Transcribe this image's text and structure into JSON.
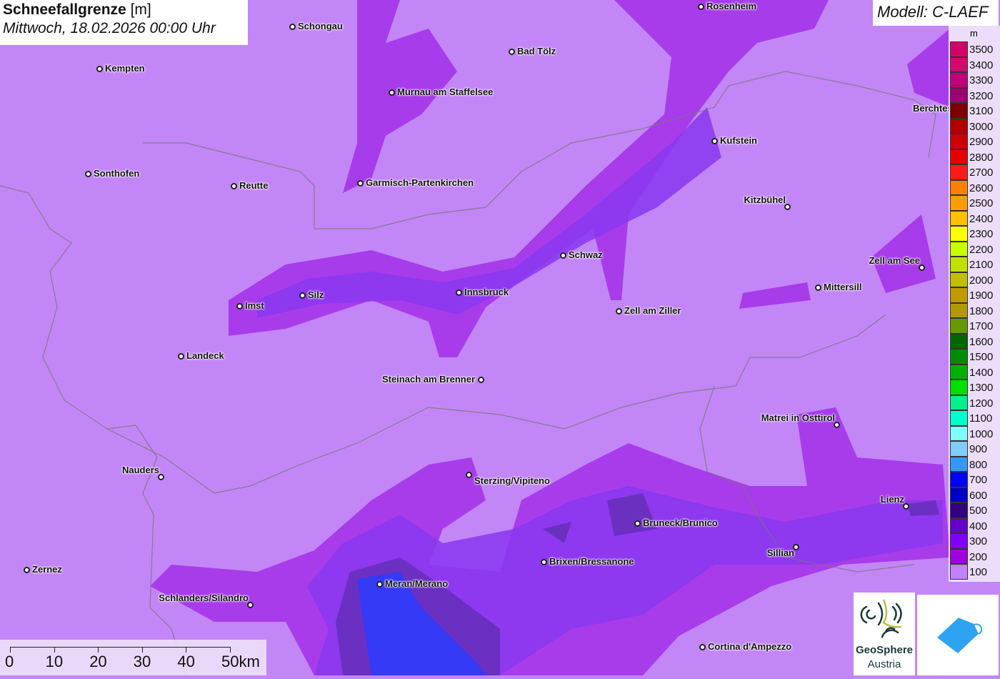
{
  "title": {
    "parameter": "Schneefallgrenze",
    "unit": "[m]",
    "datetime": "Mittwoch, 18.02.2026 00:00 Uhr"
  },
  "model": "Modell: C-LAEF",
  "legend": {
    "unit": "m",
    "entries": [
      {
        "v": "3500",
        "c": "#d4006a"
      },
      {
        "v": "3400",
        "c": "#d10b6e"
      },
      {
        "v": "3300",
        "c": "#c0007a"
      },
      {
        "v": "3200",
        "c": "#9a0072"
      },
      {
        "v": "3100",
        "c": "#7a0000"
      },
      {
        "v": "3000",
        "c": "#b00000"
      },
      {
        "v": "2900",
        "c": "#cc0000"
      },
      {
        "v": "2800",
        "c": "#e60000"
      },
      {
        "v": "2700",
        "c": "#ff1a1a"
      },
      {
        "v": "2600",
        "c": "#ff8000"
      },
      {
        "v": "2500",
        "c": "#ff9c00"
      },
      {
        "v": "2400",
        "c": "#ffc000"
      },
      {
        "v": "2300",
        "c": "#ffff00"
      },
      {
        "v": "2200",
        "c": "#c8ff00"
      },
      {
        "v": "2100",
        "c": "#c0e000"
      },
      {
        "v": "2000",
        "c": "#c0c000"
      },
      {
        "v": "1900",
        "c": "#c09a00"
      },
      {
        "v": "1800",
        "c": "#b09a00"
      },
      {
        "v": "1700",
        "c": "#669900"
      },
      {
        "v": "1600",
        "c": "#006600"
      },
      {
        "v": "1500",
        "c": "#008c00"
      },
      {
        "v": "1400",
        "c": "#00b000"
      },
      {
        "v": "1300",
        "c": "#00e000"
      },
      {
        "v": "1200",
        "c": "#00f08c"
      },
      {
        "v": "1100",
        "c": "#00ffcc"
      },
      {
        "v": "1000",
        "c": "#80ffff"
      },
      {
        "v": "900",
        "c": "#80ccff"
      },
      {
        "v": "800",
        "c": "#3399ff"
      },
      {
        "v": "700",
        "c": "#0000ff"
      },
      {
        "v": "600",
        "c": "#0000c0"
      },
      {
        "v": "500",
        "c": "#330080"
      },
      {
        "v": "400",
        "c": "#6600cc"
      },
      {
        "v": "300",
        "c": "#8000ff"
      },
      {
        "v": "200",
        "c": "#a000e0"
      },
      {
        "v": "100",
        "c": "#c080ff"
      }
    ]
  },
  "cities": [
    "Rosenheim",
    "Schongau",
    "Bad Tölz",
    "Kempten",
    "Murnau am Staffelsee",
    "Kufstein",
    "Sonthofen",
    "Reutte",
    "Garmisch-Partenkirchen",
    "Kitzbühel",
    "Schwaz",
    "Zell am See",
    "Mittersill",
    "Innsbruck",
    "Silz",
    "Imst",
    "Zell am Ziller",
    "Landeck",
    "Steinach am Brenner",
    "Matrei in Osttirol",
    "Nauders",
    "Sterzing/Vipiteno",
    "Lienz",
    "Bruneck/Brunico",
    "Brixen/Bressanone",
    "Sillian",
    "Zernez",
    "Meran/Merano",
    "Schlanders/Silandro",
    "Cortina d'Ampezzo",
    "Berchtesgaden"
  ],
  "scale": [
    "0",
    "10",
    "20",
    "30",
    "40",
    "50km"
  ],
  "logos": {
    "geosphere_1": "GeoSphere",
    "geosphere_2": "Austria"
  }
}
